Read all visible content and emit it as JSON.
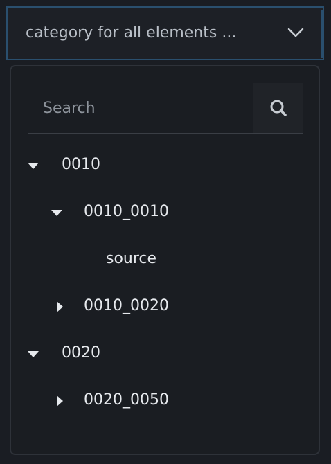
{
  "select": {
    "value": "category for all elements ...",
    "chevron_icon": "chevron-down-icon"
  },
  "search": {
    "placeholder": "Search",
    "icon": "search-icon"
  },
  "tree": {
    "items": [
      {
        "label": "0010",
        "expanded": true,
        "level": 0
      },
      {
        "label": "0010_0010",
        "expanded": true,
        "level": 1
      },
      {
        "label": "source",
        "expanded": null,
        "level": 2
      },
      {
        "label": "0010_0020",
        "expanded": false,
        "level": 1
      },
      {
        "label": "0020",
        "expanded": true,
        "level": 0
      },
      {
        "label": "0020_0050",
        "expanded": false,
        "level": 1
      }
    ]
  },
  "colors": {
    "background": "#1a1d23",
    "select_border": "#2a4f6e",
    "text": "#e6e9ed",
    "placeholder": "#8e949c"
  }
}
